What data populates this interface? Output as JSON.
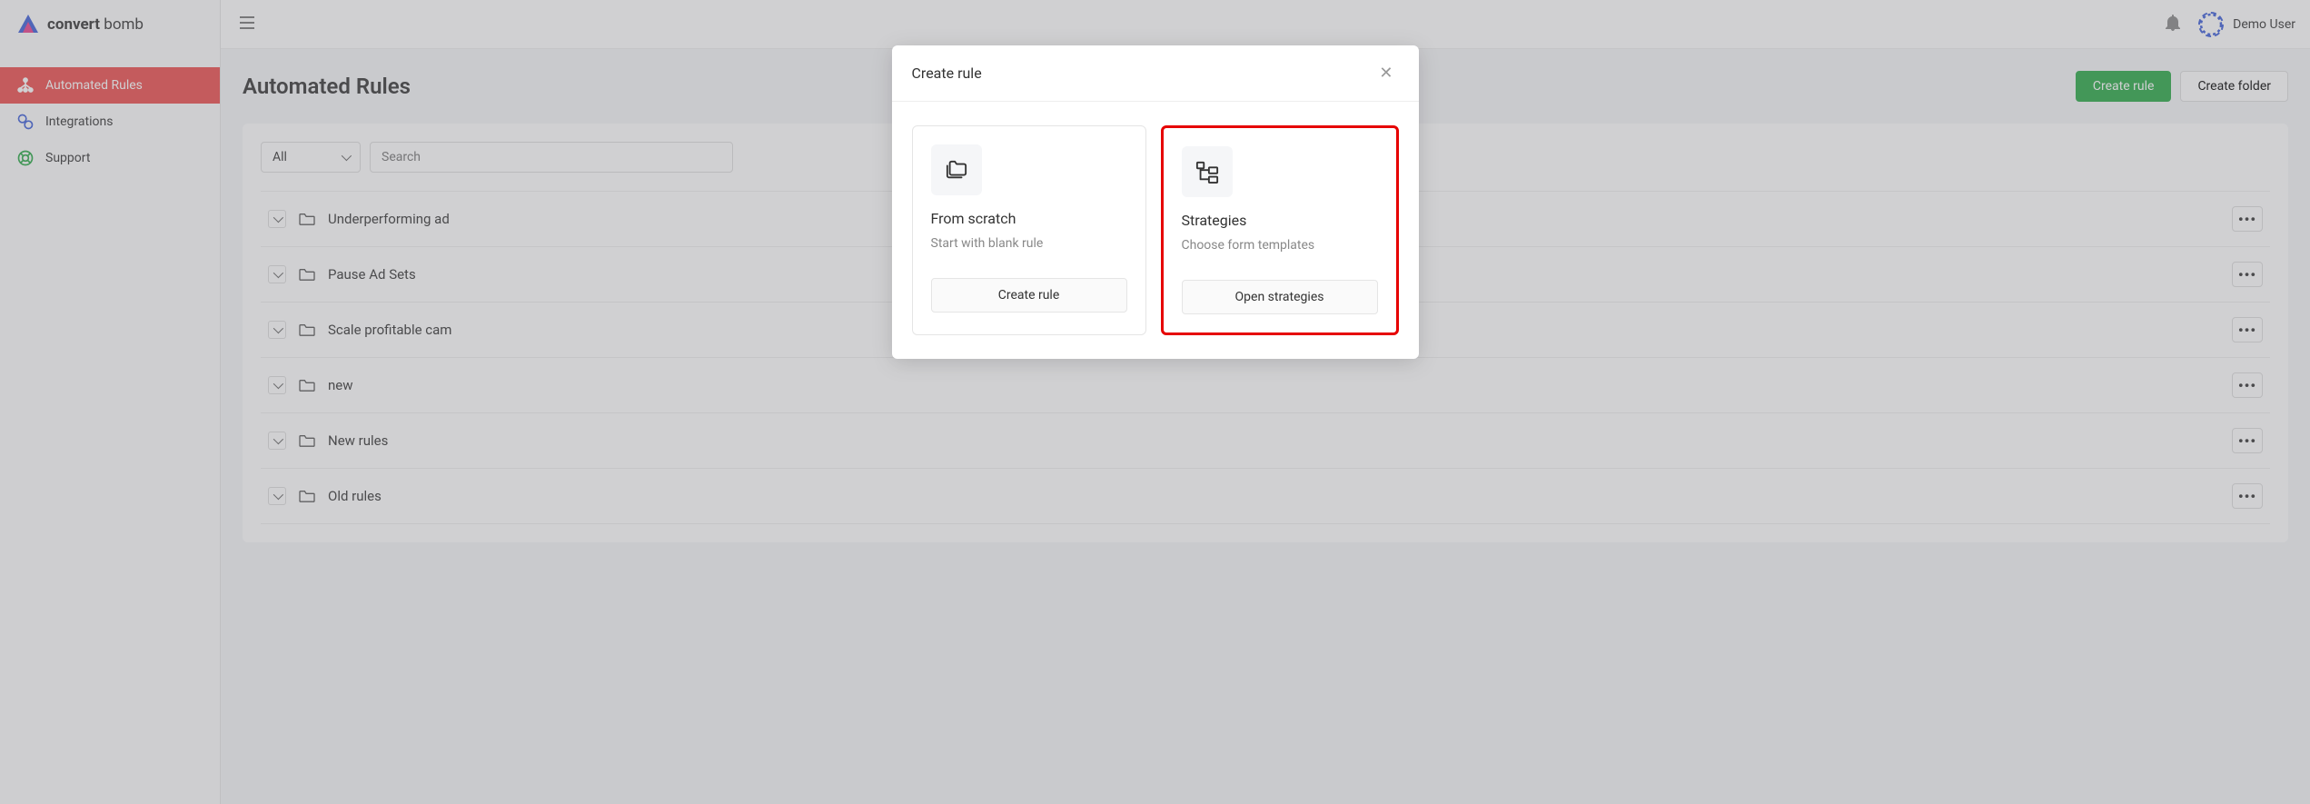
{
  "brand": {
    "name_bold": "convert",
    "name_light": " bomb"
  },
  "user": {
    "name": "Demo User"
  },
  "sidebar": {
    "items": [
      {
        "label": "Automated Rules"
      },
      {
        "label": "Integrations"
      },
      {
        "label": "Support"
      }
    ]
  },
  "page": {
    "title": "Automated Rules"
  },
  "header": {
    "create_rule": "Create rule",
    "create_folder": "Create folder"
  },
  "filters": {
    "select_label": "All",
    "search_placeholder": "Search"
  },
  "folders": [
    {
      "name": "Underperforming ad"
    },
    {
      "name": "Pause Ad Sets"
    },
    {
      "name": "Scale profitable cam"
    },
    {
      "name": "new"
    },
    {
      "name": "New rules"
    },
    {
      "name": "Old rules"
    }
  ],
  "modal": {
    "title": "Create rule",
    "options": [
      {
        "title": "From scratch",
        "subtitle": "Start with blank rule",
        "button": "Create rule"
      },
      {
        "title": "Strategies",
        "subtitle": "Choose form templates",
        "button": "Open strategies"
      }
    ]
  }
}
